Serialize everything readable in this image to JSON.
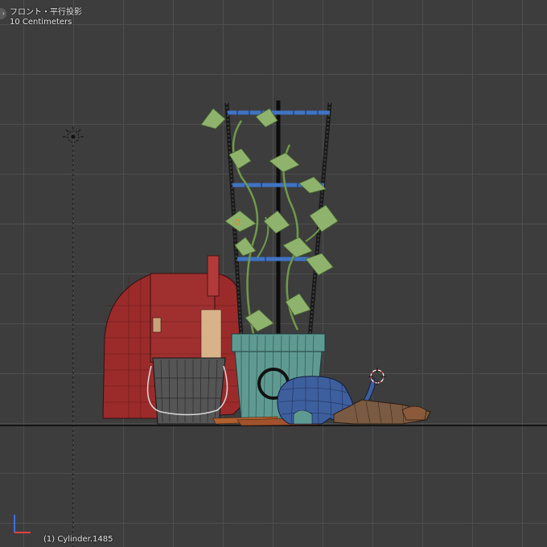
{
  "viewport": {
    "view_name": "フロント・平行投影",
    "grid_scale": "10 Centimeters",
    "active_object": "(1) Cylinder.1485",
    "background_color": "#3d3d3d",
    "grid_color": "#505050",
    "floor_line_color": "#0a0a0a"
  },
  "scene": {
    "objects": [
      "light",
      "trellis",
      "plant-vine",
      "flower-pot",
      "school-backpack",
      "bucket",
      "elephant-watering-can",
      "fallen-object",
      "3d-cursor"
    ],
    "colors": {
      "backpack": "#9b2b2b",
      "pot": "#5f9a92",
      "bucket": "#555555",
      "elephant": "#3e5f9e",
      "trellis_rungs": "#3f73c4",
      "leaves": "#8fb36d",
      "wood": "#a0522d"
    }
  },
  "axis_gizmo": {
    "x_color": "#e04040",
    "z_color": "#4070e0"
  },
  "icons": {
    "corner": "arrow-right-icon",
    "light": "light-sun-icon",
    "cursor": "3d-cursor-icon"
  }
}
